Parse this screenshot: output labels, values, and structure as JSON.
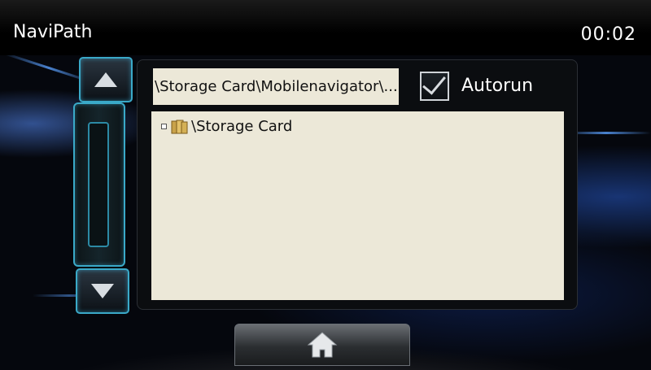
{
  "header": {
    "title": "NaviPath",
    "clock": "00:02"
  },
  "path_field": {
    "value": "\\Storage Card\\Mobilenavigator\\..."
  },
  "autorun": {
    "label": "Autorun",
    "checked": true
  },
  "file_tree": {
    "items": [
      {
        "label": "\\Storage Card",
        "icon": "folder-icon"
      }
    ]
  },
  "icons": {
    "scroll_up": "triangle-up-icon",
    "scroll_down": "triangle-down-icon",
    "home": "home-icon"
  },
  "colors": {
    "accent": "#3aa9c8",
    "list_background": "#ece8d8"
  }
}
